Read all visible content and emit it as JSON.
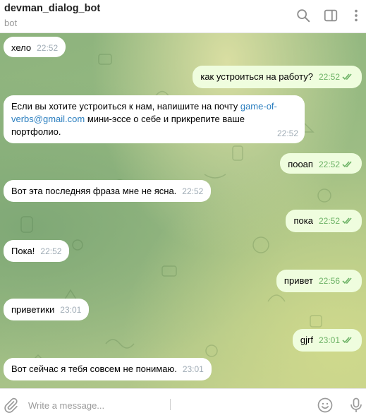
{
  "header": {
    "title": "devman_dialog_bot",
    "subtitle": "bot",
    "icons": [
      "search-icon",
      "sidebar-toggle-icon",
      "more-vertical-icon"
    ]
  },
  "messages": [
    {
      "direction": "in",
      "text": "хело",
      "time": "22:52"
    },
    {
      "direction": "out",
      "text": "как устроиться на работу?",
      "time": "22:52",
      "read": true
    },
    {
      "direction": "in",
      "text_before": "Если вы хотите устроиться к нам, напишите на почту ",
      "link": "game-of-verbs@gmail.com",
      "text_after": " мини-эссе о себе и прикрепите ваше портфолио.",
      "time": "22:52"
    },
    {
      "direction": "out",
      "text": "пооап",
      "time": "22:52",
      "read": true
    },
    {
      "direction": "in",
      "text": "Вот эта последняя фраза мне не ясна.",
      "time": "22:52"
    },
    {
      "direction": "out",
      "text": "пока",
      "time": "22:52",
      "read": true
    },
    {
      "direction": "in",
      "text": "Пока!",
      "time": "22:52"
    },
    {
      "direction": "out",
      "text": "привет",
      "time": "22:56",
      "read": true
    },
    {
      "direction": "in",
      "text": "приветики",
      "time": "23:01"
    },
    {
      "direction": "out",
      "text": "gjrf",
      "time": "23:01",
      "read": true
    },
    {
      "direction": "in",
      "text": "Вот сейчас я тебя совсем не понимаю.",
      "time": "23:01"
    }
  ],
  "composer": {
    "placeholder": "Write a message...",
    "icons": [
      "attach-icon",
      "emoji-icon",
      "microphone-icon"
    ]
  },
  "colors": {
    "incoming_bubble": "#ffffff",
    "outgoing_bubble": "#effdde",
    "link": "#2a7ebf",
    "read_ticks": "#6cb265",
    "time_in": "#a0acb6"
  }
}
